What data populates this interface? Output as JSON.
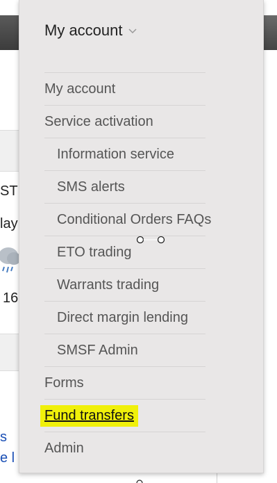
{
  "background": {
    "fragment_1": "ST",
    "fragment_2": "lay",
    "fragment_3": "16",
    "fragment_4": "s",
    "fragment_5": "e l"
  },
  "menu": {
    "title": "My account",
    "items": [
      {
        "label": "My account",
        "level": 1
      },
      {
        "label": "Service activation",
        "level": 1
      },
      {
        "label": "Information service",
        "level": 2
      },
      {
        "label": "SMS alerts",
        "level": 2
      },
      {
        "label": "Conditional Orders FAQs",
        "level": 2
      },
      {
        "label": "ETO trading",
        "level": 2
      },
      {
        "label": "Warrants trading",
        "level": 2
      },
      {
        "label": "Direct margin lending",
        "level": 2
      },
      {
        "label": "SMSF Admin",
        "level": 2
      },
      {
        "label": "Forms",
        "level": 1
      },
      {
        "label": "Fund transfers",
        "level": 1,
        "highlighted": true
      },
      {
        "label": "Admin",
        "level": 1
      }
    ]
  },
  "colors": {
    "menu_bg": "#e9e7e7",
    "highlight": "#f0f00a",
    "link": "#1a4fb5"
  }
}
